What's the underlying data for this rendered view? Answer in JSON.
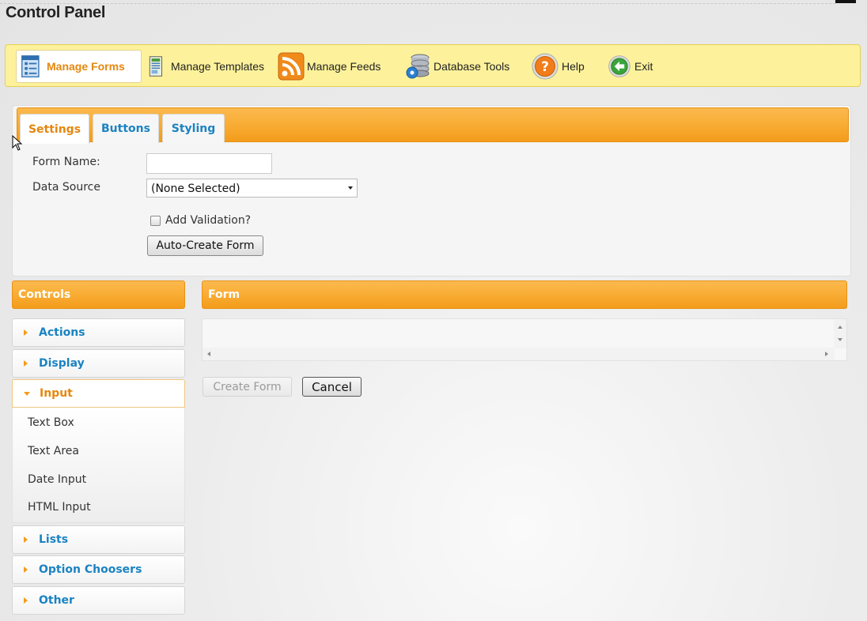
{
  "page": {
    "title": "Control Panel"
  },
  "toolbar": {
    "items": [
      {
        "label": "Manage Forms",
        "icon": "forms-icon",
        "active": true
      },
      {
        "label": "Manage Templates",
        "icon": "templates-icon"
      },
      {
        "label": "Manage Feeds",
        "icon": "rss-icon"
      },
      {
        "label": "Database Tools",
        "icon": "database-gear-icon"
      },
      {
        "label": "Help",
        "icon": "help-icon"
      },
      {
        "label": "Exit",
        "icon": "exit-icon"
      }
    ]
  },
  "settings": {
    "tabs": [
      {
        "label": "Settings",
        "active": true
      },
      {
        "label": "Buttons"
      },
      {
        "label": "Styling"
      }
    ],
    "form_name_label": "Form Name:",
    "form_name_value": "",
    "data_source_label": "Data Source",
    "data_source_value": "(None Selected)",
    "validation_label": "Add Validation?",
    "validation_checked": false,
    "auto_create_label": "Auto-Create Form"
  },
  "controls": {
    "header": "Controls",
    "sections": [
      {
        "label": "Actions",
        "open": false
      },
      {
        "label": "Display",
        "open": false
      },
      {
        "label": "Input",
        "open": true,
        "items": [
          "Text Box",
          "Text Area",
          "Date Input",
          "HTML Input"
        ]
      },
      {
        "label": "Lists",
        "open": false
      },
      {
        "label": "Option Choosers",
        "open": false
      },
      {
        "label": "Other",
        "open": false
      }
    ]
  },
  "form": {
    "header": "Form",
    "create_label": "Create Form",
    "cancel_label": "Cancel"
  },
  "colors": {
    "accent_orange": "#f39c1b",
    "link_blue": "#1b83c2",
    "toolbar_yellow": "#fdf29b"
  }
}
